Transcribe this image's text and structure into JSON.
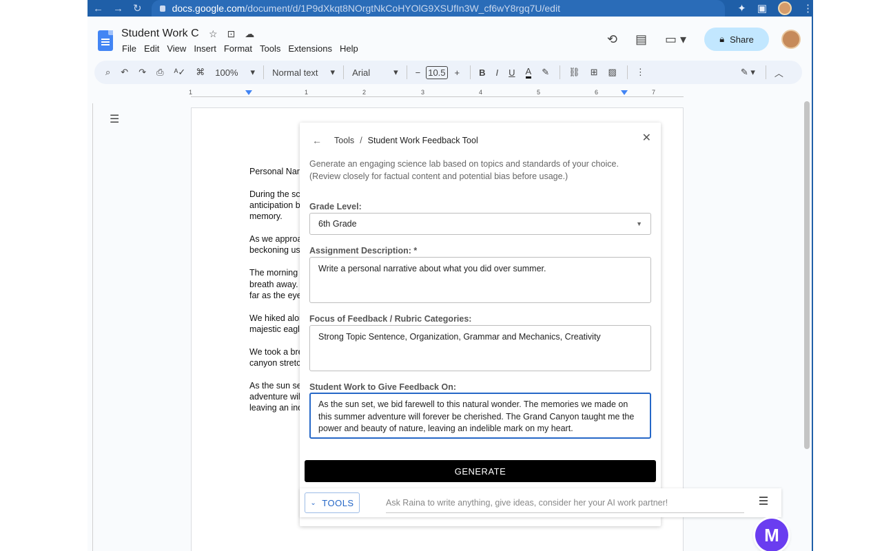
{
  "browser": {
    "url": "docs.google.com/document/d/1P9dXkqt8NOrgtNkCoHYOlG9XSUfIn3W_cf6wY8rgq7U/edit",
    "url_host": "docs.google.com",
    "url_path": "/document/d/1P9dXkqt8NOrgtNkCoHYOlG9XSUfIn3W_cf6wY8rgq7U/edit"
  },
  "docs": {
    "title": "Student Work C",
    "menu": [
      "File",
      "Edit",
      "View",
      "Insert",
      "Format",
      "Tools",
      "Extensions",
      "Help"
    ],
    "share_label": "Share"
  },
  "toolbar": {
    "zoom": "100%",
    "style": "Normal text",
    "font": "Arial",
    "font_size": "10.5",
    "bold": "B",
    "italic": "I",
    "underline": "U",
    "text_color": "A"
  },
  "ruler": {
    "numbers": [
      "1",
      "1",
      "2",
      "3",
      "4",
      "5",
      "6",
      "7"
    ]
  },
  "document": {
    "lines": [
      "Personal Narr",
      "During the sce\nanticipation bu\nmemory.",
      "As we approa\nbeckoning us",
      "The morning s\nbreath away. T\nfar as the eye",
      "We hiked alon\nmajestic eagle",
      "We took a bre\ncanyon stretch",
      "As the sun se\nadventure will\nleaving an ind"
    ]
  },
  "panel": {
    "breadcrumb_root": "Tools",
    "breadcrumb_sep": "/",
    "breadcrumb_current": "Student Work Feedback Tool",
    "description": "Generate an engaging science lab based on topics and standards of your choice. (Review closely for factual content and potential bias before usage.)",
    "grade_label": "Grade Level:",
    "grade_value": "6th Grade",
    "assignment_label": "Assignment Description: *",
    "assignment_value": "Write a personal narrative about what you did over summer.",
    "focus_label": "Focus of Feedback / Rubric Categories:",
    "focus_value": "Strong Topic Sentence, Organization, Grammar and Mechanics, Creativity",
    "student_label": "Student Work to Give Feedback On:",
    "student_value": "As the sun set, we bid farewell to this natural wonder. The memories we made on this summer adventure will forever be cherished. The Grand Canyon taught me the power and beauty of nature, leaving an indelible mark on my heart.",
    "generate_label": "GENERATE"
  },
  "raina": {
    "tools_label": "TOOLS",
    "placeholder": "Ask Raina to write anything, give ideas, consider her your AI work partner!",
    "logo_letter": "M"
  },
  "colors": {
    "chrome_blue": "#1f5fa8",
    "share_bg": "#c2e7ff",
    "focus_blue": "#2567c7",
    "logo_purple": "#6a3df0"
  }
}
